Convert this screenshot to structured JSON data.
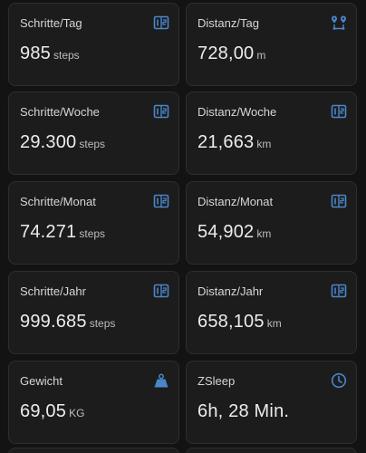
{
  "colors": {
    "accent": "#4a86c8",
    "background": "#131313",
    "card": "#1c1c1c",
    "text": "#ececec",
    "muted": "#bdbdbd"
  },
  "cards": [
    {
      "title": "Schritte/Tag",
      "value": "985",
      "unit": "steps",
      "icon": "counter-icon"
    },
    {
      "title": "Distanz/Tag",
      "value": "728,00",
      "unit": "m",
      "icon": "map-route-icon"
    },
    {
      "title": "Schritte/Woche",
      "value": "29.300",
      "unit": "steps",
      "icon": "counter-icon"
    },
    {
      "title": "Distanz/Woche",
      "value": "21,663",
      "unit": "km",
      "icon": "counter-icon"
    },
    {
      "title": "Schritte/Monat",
      "value": "74.271",
      "unit": "steps",
      "icon": "counter-icon"
    },
    {
      "title": "Distanz/Monat",
      "value": "54,902",
      "unit": "km",
      "icon": "counter-icon"
    },
    {
      "title": "Schritte/Jahr",
      "value": "999.685",
      "unit": "steps",
      "icon": "counter-icon"
    },
    {
      "title": "Distanz/Jahr",
      "value": "658,105",
      "unit": "km",
      "icon": "counter-icon"
    },
    {
      "title": "Gewicht",
      "value": "69,05",
      "unit": "KG",
      "icon": "weight-icon"
    },
    {
      "title": "ZSleep",
      "value": "6h, 28 Min.",
      "unit": "",
      "icon": "clock-icon"
    }
  ]
}
